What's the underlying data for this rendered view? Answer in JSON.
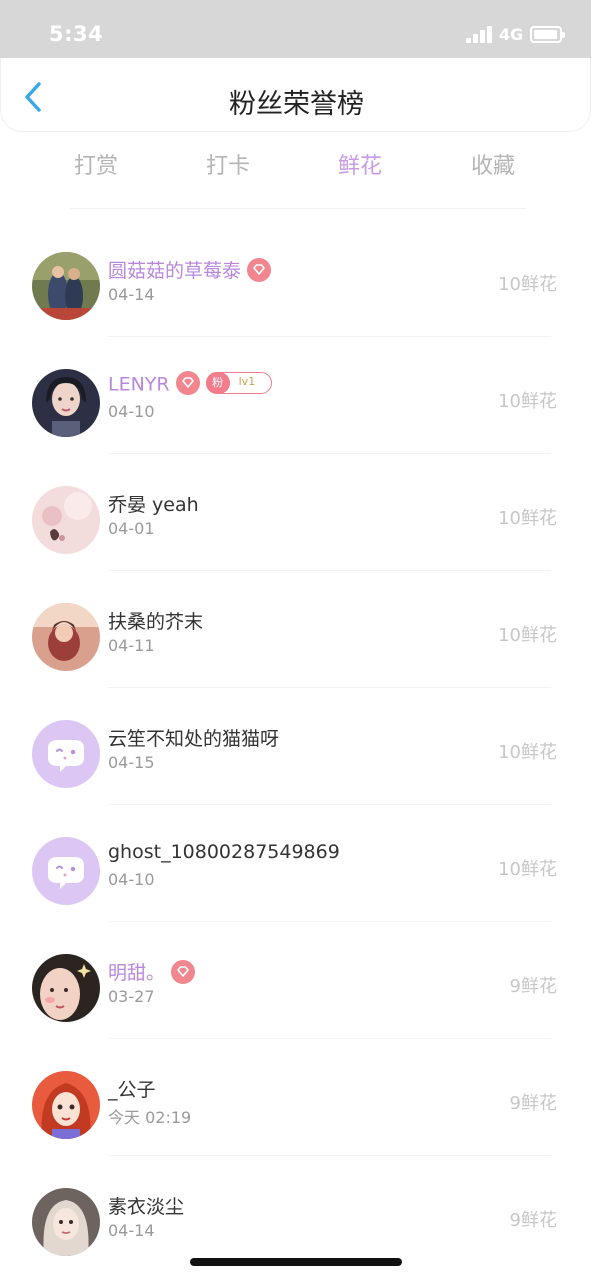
{
  "status_bar": {
    "time": "5:34",
    "network": "4G"
  },
  "nav": {
    "title": "粉丝荣誉榜"
  },
  "tabs": [
    {
      "label": "打赏",
      "active": false
    },
    {
      "label": "打卡",
      "active": false
    },
    {
      "label": "鲜花",
      "active": true
    },
    {
      "label": "收藏",
      "active": false
    }
  ],
  "accent_color": "#c79be6",
  "fans": [
    {
      "name": "圆菇菇的草莓泰",
      "date": "04-14",
      "value": "10鲜花",
      "vip": true,
      "avatar": "photo"
    },
    {
      "name": "LENYR",
      "date": "04-10",
      "value": "10鲜花",
      "vip": true,
      "fan_badge": {
        "label": "粉",
        "level": "lv1"
      },
      "avatar": "photo"
    },
    {
      "name": "乔晏 yeah",
      "date": "04-01",
      "value": "10鲜花",
      "vip": false,
      "avatar": "photo"
    },
    {
      "name": "扶桑的芥末",
      "date": "04-11",
      "value": "10鲜花",
      "vip": false,
      "avatar": "photo"
    },
    {
      "name": "云笙不知处的猫猫呀",
      "date": "04-15",
      "value": "10鲜花",
      "vip": false,
      "avatar": "default-chat-bubble-icon"
    },
    {
      "name": "ghost_10800287549869",
      "date": "04-10",
      "value": "10鲜花",
      "vip": false,
      "avatar": "default-chat-bubble-icon"
    },
    {
      "name": "明甜。",
      "date": "03-27",
      "value": "9鲜花",
      "vip": true,
      "avatar": "photo"
    },
    {
      "name": "_公子",
      "date": "今天 02:19",
      "value": "9鲜花",
      "vip": false,
      "avatar": "photo"
    },
    {
      "name": "素衣淡尘",
      "date": "04-14",
      "value": "9鲜花",
      "vip": false,
      "avatar": "photo"
    }
  ]
}
